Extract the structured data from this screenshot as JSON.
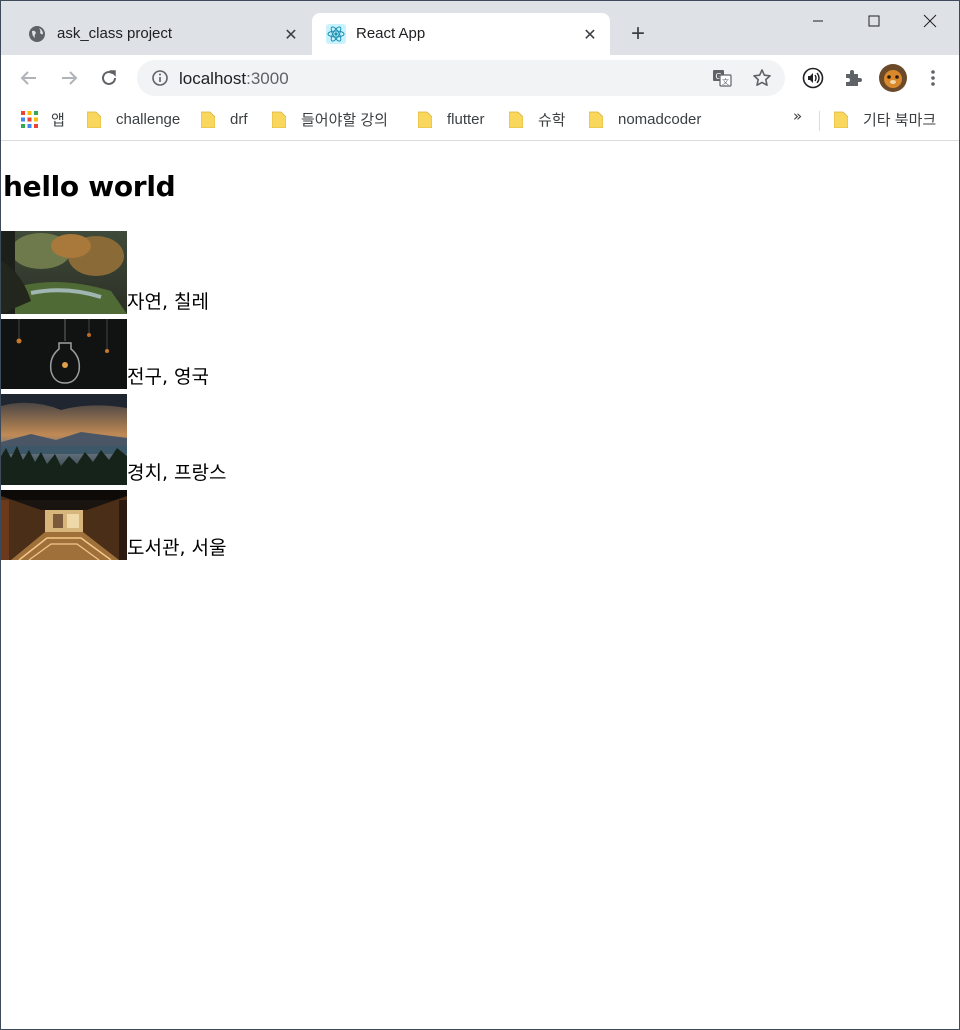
{
  "tabs": [
    {
      "title": "ask_class project",
      "active": false
    },
    {
      "title": "React App",
      "active": true
    }
  ],
  "address_bar": {
    "host": "localhost",
    "port": ":3000"
  },
  "bookmarks": {
    "apps_label": "앱",
    "items": [
      "challenge",
      "drf",
      "들어야할 강의",
      "flutter",
      "슈학",
      "nomadcoder"
    ],
    "more": "»",
    "other_label": "기타 북마크"
  },
  "page": {
    "heading": "hello world",
    "items": [
      {
        "caption": "자연, 칠레"
      },
      {
        "caption": "전구, 영국"
      },
      {
        "caption": "경치, 프랑스"
      },
      {
        "caption": "도서관, 서울"
      }
    ]
  },
  "colors": {
    "tab_strip": "#dee1e6",
    "omnibox": "#f1f3f4",
    "folder": "#f9d75c"
  }
}
